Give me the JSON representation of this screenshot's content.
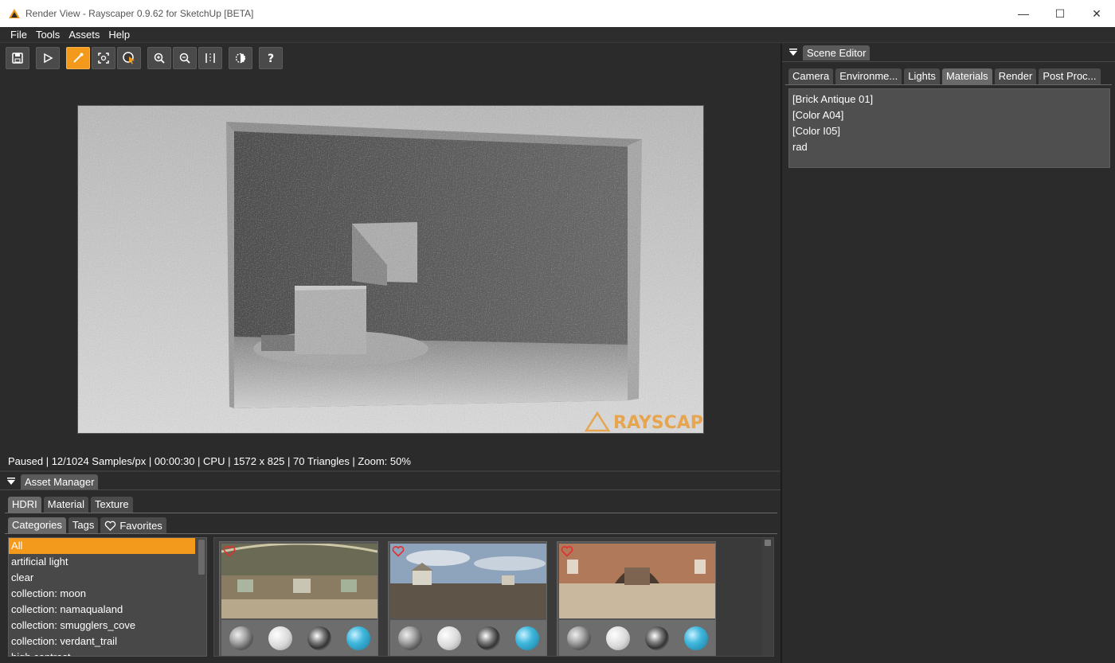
{
  "window": {
    "title": "Render View - Rayscaper 0.9.62 for SketchUp [BETA]",
    "minimize": "—",
    "maximize": "☐",
    "close": "✕"
  },
  "menu": [
    "File",
    "Tools",
    "Assets",
    "Help"
  ],
  "toolbar": {
    "buttons": [
      {
        "name": "save-icon",
        "active": false
      },
      {
        "name": "play-icon",
        "active": false
      },
      {
        "name": "pick-material-icon",
        "active": true
      },
      {
        "name": "focus-region-icon",
        "active": false
      },
      {
        "name": "select-cursor-icon",
        "active": false
      },
      {
        "name": "zoom-in-icon",
        "active": false
      },
      {
        "name": "zoom-out-icon",
        "active": false
      },
      {
        "name": "fit-view-icon",
        "active": false
      },
      {
        "name": "compare-icon",
        "active": false
      },
      {
        "name": "help-icon",
        "active": false
      }
    ],
    "accent": "#f39a1c"
  },
  "render": {
    "watermark": "RAYSCAPER"
  },
  "status": "Paused | 12/1024 Samples/px | 00:00:30 | CPU | 1572 x 825 | 70 Triangles | Zoom: 50%",
  "scene_editor": {
    "title": "Scene Editor",
    "tabs": [
      "Camera",
      "Environme...",
      "Lights",
      "Materials",
      "Render",
      "Post Proc..."
    ],
    "active_tab": "Materials",
    "materials": [
      "[Brick Antique 01]",
      "[Color A04]",
      "[Color I05]",
      "rad"
    ]
  },
  "asset_manager": {
    "title": "Asset Manager",
    "tabs": [
      "HDRI",
      "Material",
      "Texture"
    ],
    "active_tab": "HDRI",
    "filter_tabs": [
      "Categories",
      "Tags",
      "Favorites"
    ],
    "active_filter": "Categories",
    "categories": [
      "All",
      "artificial light",
      "clear",
      "collection: moon",
      "collection: namaqualand",
      "collection: smugglers_cove",
      "collection: verdant_trail",
      "high contrast"
    ],
    "selected_category": "All"
  }
}
